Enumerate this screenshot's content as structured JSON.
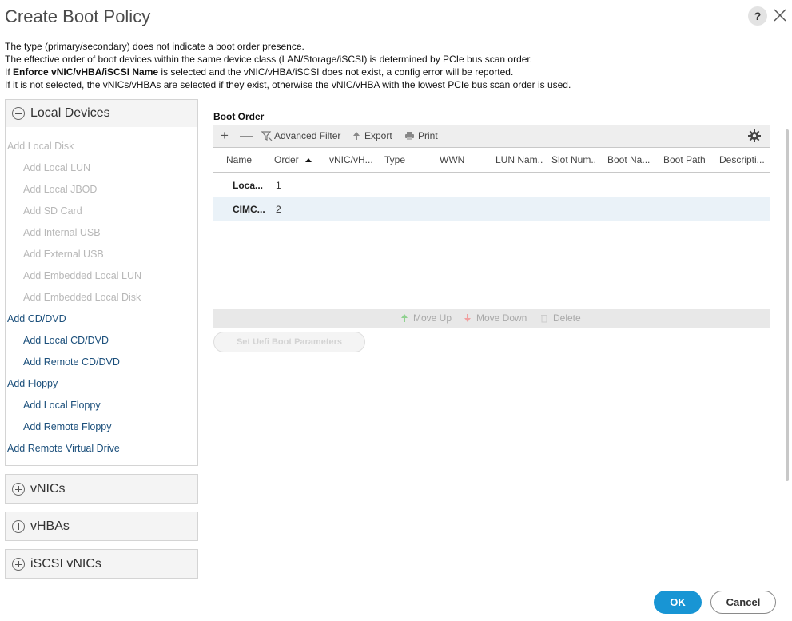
{
  "dialog": {
    "title": "Create Boot Policy",
    "help_label": "?"
  },
  "info": {
    "line1": "The type (primary/secondary) does not indicate a boot order presence.",
    "line2": "The effective order of boot devices within the same device class (LAN/Storage/iSCSI) is determined by PCIe bus scan order.",
    "line3_prefix": "If ",
    "line3_bold": "Enforce vNIC/vHBA/iSCSI Name",
    "line3_suffix": " is selected and the vNIC/vHBA/iSCSI does not exist, a config error will be reported.",
    "line4": "If it is not selected, the vNICs/vHBAs are selected if they exist, otherwise the vNIC/vHBA with the lowest PCIe bus scan order is used."
  },
  "left_panel": {
    "local_devices": {
      "title": "Local Devices",
      "items": [
        {
          "label": "Add Local Disk",
          "enabled": false
        },
        {
          "label": "Add Local LUN",
          "enabled": false
        },
        {
          "label": "Add Local JBOD",
          "enabled": false
        },
        {
          "label": "Add SD Card",
          "enabled": false
        },
        {
          "label": "Add Internal USB",
          "enabled": false
        },
        {
          "label": "Add External USB",
          "enabled": false
        },
        {
          "label": "Add Embedded Local LUN",
          "enabled": false
        },
        {
          "label": "Add Embedded Local Disk",
          "enabled": false
        },
        {
          "label": "Add CD/DVD",
          "enabled": true
        },
        {
          "label": "Add Local CD/DVD",
          "enabled": true
        },
        {
          "label": "Add Remote CD/DVD",
          "enabled": true
        },
        {
          "label": "Add Floppy",
          "enabled": true
        },
        {
          "label": "Add Local Floppy",
          "enabled": true
        },
        {
          "label": "Add Remote Floppy",
          "enabled": true
        },
        {
          "label": "Add Remote Virtual Drive",
          "enabled": true
        }
      ]
    },
    "sections": [
      {
        "title": "vNICs"
      },
      {
        "title": "vHBAs"
      },
      {
        "title": "iSCSI vNICs"
      }
    ]
  },
  "boot_order": {
    "label": "Boot Order",
    "toolbar": {
      "add": "+",
      "remove": "—",
      "filter": "Advanced Filter",
      "export": "Export",
      "print": "Print"
    },
    "columns": [
      "Name",
      "Order",
      "vNIC/vH...",
      "Type",
      "WWN",
      "LUN Nam..",
      "Slot Num..",
      "Boot Na...",
      "Boot Path",
      "Descripti..."
    ],
    "rows": [
      {
        "name": "Loca...",
        "order": "1"
      },
      {
        "name": "CIMC...",
        "order": "2"
      }
    ],
    "actions": {
      "move_up": "Move Up",
      "move_down": "Move Down",
      "delete": "Delete"
    },
    "uefi_button": "Set Uefi Boot Parameters"
  },
  "footer": {
    "ok": "OK",
    "cancel": "Cancel"
  }
}
